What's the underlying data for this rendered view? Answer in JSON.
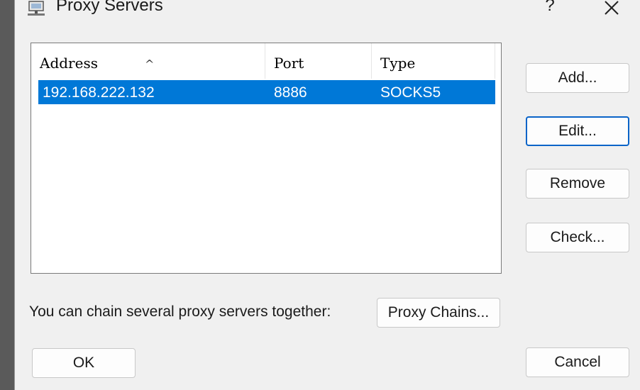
{
  "window": {
    "title": "Proxy Servers",
    "help_label": "?",
    "close_icon": "close-icon"
  },
  "list": {
    "columns": [
      "Address",
      "Port",
      "Type"
    ],
    "sort_indicator": "^",
    "rows": [
      {
        "address": "192.168.222.132",
        "port": "8886",
        "type": "SOCKS5",
        "selected": true
      }
    ]
  },
  "side_buttons": {
    "add": "Add...",
    "edit": "Edit...",
    "remove": "Remove",
    "check": "Check..."
  },
  "chain": {
    "text": "You can chain several proxy servers together:",
    "button": "Proxy Chains..."
  },
  "footer": {
    "ok": "OK",
    "cancel": "Cancel"
  },
  "colors": {
    "selection": "#0078d7",
    "focus_border": "#0a64c8",
    "dialog_bg": "#f0f0f0"
  }
}
